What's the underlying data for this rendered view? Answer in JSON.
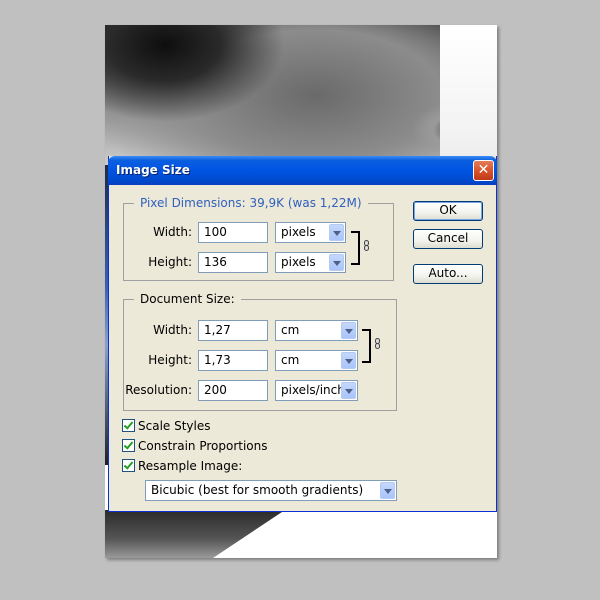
{
  "dialog": {
    "title": "Image Size",
    "close_glyph": "✕",
    "buttons": {
      "ok": "OK",
      "cancel": "Cancel",
      "auto": "Auto..."
    }
  },
  "pixel_dimensions": {
    "legend": "Pixel Dimensions:  39,9K (was 1,22M)",
    "width_label": "Width:",
    "width_value": "100",
    "width_unit": "pixels",
    "height_label": "Height:",
    "height_value": "136",
    "height_unit": "pixels"
  },
  "document_size": {
    "legend": "Document Size:",
    "width_label": "Width:",
    "width_value": "1,27",
    "width_unit": "cm",
    "height_label": "Height:",
    "height_value": "1,73",
    "height_unit": "cm",
    "resolution_label": "Resolution:",
    "resolution_value": "200",
    "resolution_unit": "pixels/inch"
  },
  "options": {
    "scale_styles": {
      "label": "Scale Styles",
      "checked": true
    },
    "constrain_proportions": {
      "label": "Constrain Proportions",
      "checked": true
    },
    "resample_image": {
      "label": "Resample Image:",
      "checked": true
    },
    "resample_method": "Bicubic (best for smooth gradients)"
  },
  "colors": {
    "title_bar": "#0054e3",
    "dialog_bg": "#ece9d8",
    "legend_blue": "#2f5fbf",
    "close_button": "#d9542b",
    "check_green": "#21a121"
  }
}
